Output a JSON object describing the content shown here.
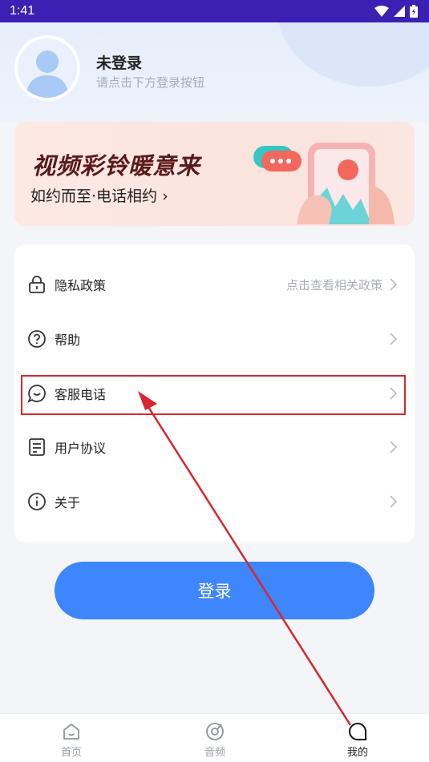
{
  "status_bar": {
    "time": "1:41"
  },
  "profile": {
    "name": "未登录",
    "hint": "请点击下方登录按钮"
  },
  "banner": {
    "title": "视频彩铃暖意来",
    "subtitle": "如约而至·电话相约 ›"
  },
  "menu": {
    "items": [
      {
        "label": "隐私政策",
        "hint": "点击查看相关政策",
        "icon": "lock-icon"
      },
      {
        "label": "帮助",
        "hint": "",
        "icon": "help-icon"
      },
      {
        "label": "客服电话",
        "hint": "",
        "icon": "chat-icon"
      },
      {
        "label": "用户协议",
        "hint": "",
        "icon": "document-icon"
      },
      {
        "label": "关于",
        "hint": "",
        "icon": "info-icon"
      }
    ]
  },
  "login_button": {
    "label": "登录"
  },
  "bottom_nav": {
    "items": [
      {
        "label": "首页",
        "icon": "home-icon"
      },
      {
        "label": "音频",
        "icon": "audio-icon"
      },
      {
        "label": "我的",
        "icon": "profile-icon",
        "active": true
      }
    ]
  },
  "colors": {
    "status_bar": "#3c1fb3",
    "accent": "#3d86fb",
    "annotation": "#d6272e"
  }
}
